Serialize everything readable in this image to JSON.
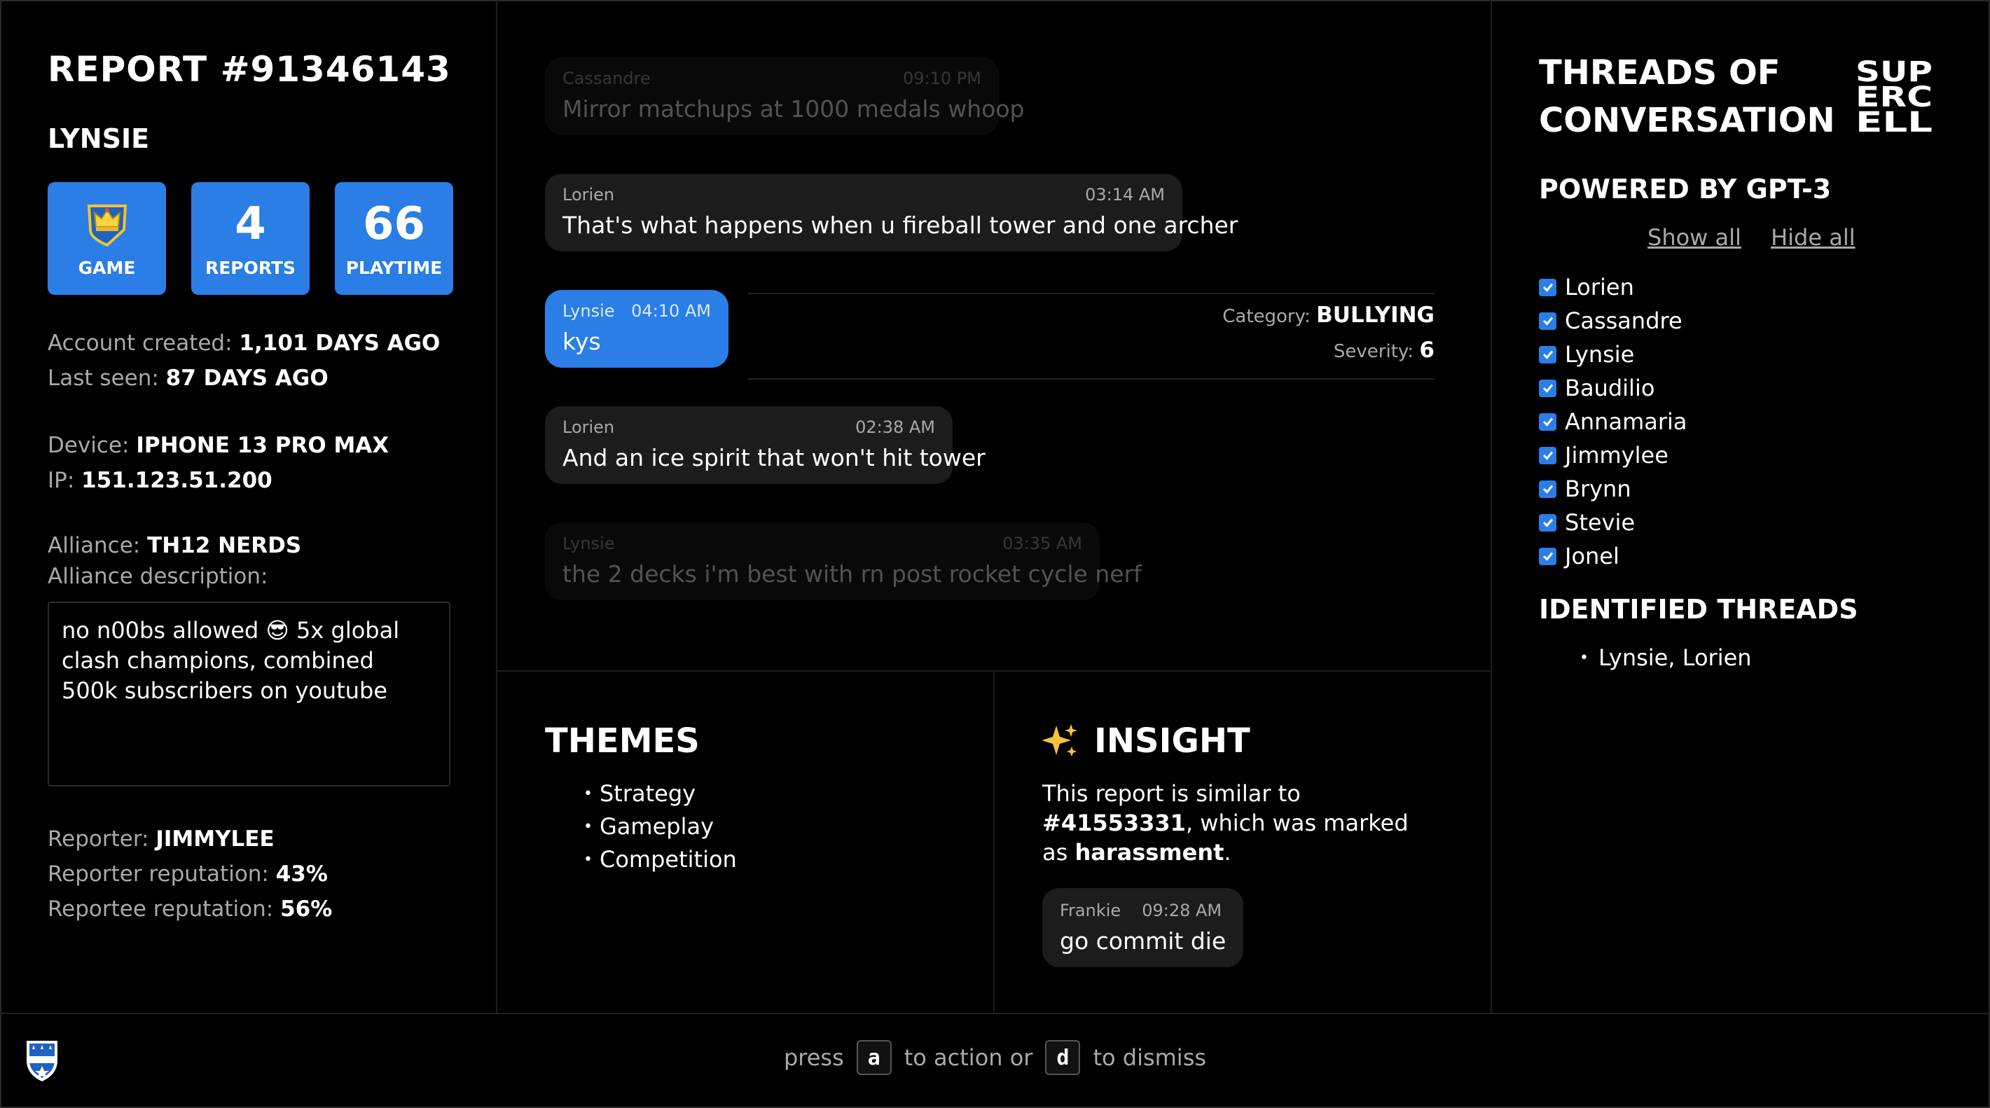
{
  "report": {
    "title": "REPORT #91346143",
    "username": "LYNSIE",
    "stats": [
      {
        "value": "",
        "label": "GAME",
        "icon": "crown-shield-icon"
      },
      {
        "value": "4",
        "label": "REPORTS"
      },
      {
        "value": "66",
        "label": "PLAYTIME"
      }
    ],
    "account_created_label": "Account created: ",
    "account_created_value": "1,101 DAYS AGO",
    "last_seen_label": "Last seen: ",
    "last_seen_value": "87 DAYS AGO",
    "device_label": "Device: ",
    "device_value": "IPHONE 13 PRO MAX",
    "ip_label": "IP: ",
    "ip_value": "151.123.51.200",
    "alliance_label": "Alliance: ",
    "alliance_value": "TH12 NERDS",
    "alliance_desc_label": "Alliance description:",
    "alliance_desc": "no n00bs allowed 😎 5x global clash champions, combined 500k subscribers on youtube",
    "reporter_label": "Reporter: ",
    "reporter_value": "JIMMYLEE",
    "reporter_rep_label": "Reporter reputation: ",
    "reporter_rep_value": "43%",
    "reportee_rep_label": "Reportee reputation: ",
    "reportee_rep_value": "56%"
  },
  "chat": {
    "messages": [
      {
        "author": "Cassandre",
        "time": "09:10 PM",
        "text": "Mirror matchups at 1000 medals whoop",
        "faded": true
      },
      {
        "author": "Lorien",
        "time": "03:14 AM",
        "text": "That's what happens when u fireball tower and one archer"
      },
      {
        "author": "Lynsie",
        "time": "04:10 AM",
        "text": "kys",
        "flagged": true
      },
      {
        "author": "Lorien",
        "time": "02:38 AM",
        "text": "And an ice spirit that won't hit tower"
      },
      {
        "author": "Lynsie",
        "time": "03:35 AM",
        "text": "the 2 decks i'm best with rn post rocket cycle nerf",
        "faded": true
      }
    ],
    "flag": {
      "category_label": "Category: ",
      "category_value": "BULLYING",
      "severity_label": "Severity: ",
      "severity_value": "6"
    }
  },
  "themes": {
    "title": "THEMES",
    "items": [
      "Strategy",
      "Gameplay",
      "Competition"
    ]
  },
  "insight": {
    "title": "INSIGHT",
    "text_1": "This report is similar to ",
    "report_ref": "#41553331",
    "text_2": ", which was marked as ",
    "marked_as": "harassment",
    "text_3": ".",
    "quote": {
      "author": "Frankie",
      "time": "09:28 AM",
      "text": "go commit die"
    }
  },
  "right": {
    "title": "THREADS OF CONVERSATION",
    "logo_text": "SUPERCELL",
    "powered": "POWERED BY GPT-3",
    "show_all": "Show all",
    "hide_all": "Hide all",
    "users": [
      "Lorien",
      "Cassandre",
      "Lynsie",
      "Baudilio",
      "Annamaria",
      "Jimmylee",
      "Brynn",
      "Stevie",
      "Jonel"
    ],
    "identified_title": "IDENTIFIED THREADS",
    "identified": [
      "Lynsie, Lorien"
    ]
  },
  "footer": {
    "press": "press",
    "key_a": "a",
    "to_action": "to action or",
    "key_d": "d",
    "to_dismiss": "to dismiss"
  },
  "colors": {
    "accent": "#2a7ee6",
    "bubble": "#1c1c1c",
    "muted": "#a9a9a9"
  }
}
